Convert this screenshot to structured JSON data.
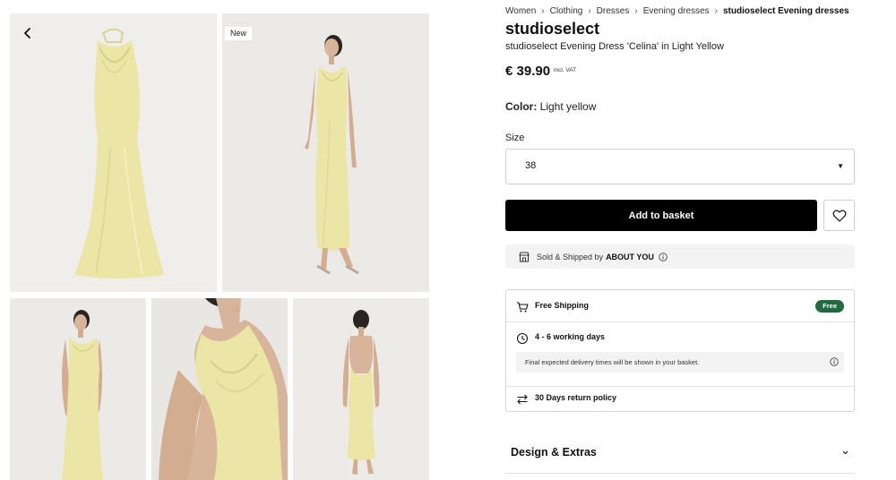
{
  "gallery": {
    "back_icon": "chevron-left-icon",
    "new_badge": "New",
    "images": [
      {
        "alt": "dress-flat-lay"
      },
      {
        "alt": "model-front-full"
      },
      {
        "alt": "model-three-quarter"
      },
      {
        "alt": "neckline-close-up"
      },
      {
        "alt": "model-back-full"
      }
    ]
  },
  "breadcrumb": {
    "items": [
      "Women",
      "Clothing",
      "Dresses",
      "Evening dresses"
    ],
    "current": "studioselect Evening dresses",
    "separator": "›"
  },
  "product": {
    "brand": "studioselect",
    "name": "studioselect Evening Dress 'Celina' in Light Yellow",
    "price": "€ 39.90",
    "price_note": "incl. VAT",
    "color_label": "Color:",
    "color_value": "Light yellow",
    "size_label": "Size",
    "size_value": "38",
    "size_caret": "▼"
  },
  "actions": {
    "add_to_basket": "Add to basket",
    "wishlist_icon": "heart-icon"
  },
  "seller": {
    "text": "Sold & Shipped by",
    "name": "ABOUT YOU"
  },
  "shipping": {
    "free_shipping_label": "Free Shipping",
    "free_badge": "Free",
    "delivery_time": "4 - 6 working days",
    "delivery_note": "Final expected delivery times will be shown in your basket.",
    "return_policy": "30 Days return policy"
  },
  "accordion": {
    "title": "Design & Extras"
  },
  "colors": {
    "dress": "#ece6a6",
    "badge_green": "#1f6b3f",
    "button_black": "#000000"
  }
}
